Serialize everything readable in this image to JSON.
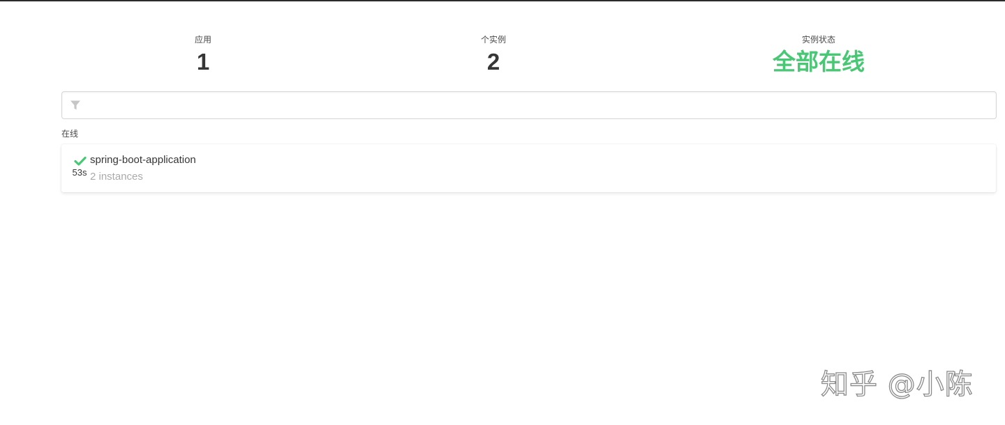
{
  "stats": {
    "applications": {
      "label": "应用",
      "value": "1"
    },
    "instances": {
      "label": "个实例",
      "value": "2"
    },
    "status": {
      "label": "实例状态",
      "value": "全部在线",
      "color": "#48c774"
    }
  },
  "filter": {
    "icon": "filter-icon",
    "value": "",
    "placeholder": ""
  },
  "section": {
    "title": "在线"
  },
  "applications": [
    {
      "name": "spring-boot-application",
      "instances_text": "2 instances",
      "status_icon": "check-icon",
      "status_color": "#48c774",
      "time": "53s"
    }
  ],
  "watermark": "知乎 @小陈"
}
